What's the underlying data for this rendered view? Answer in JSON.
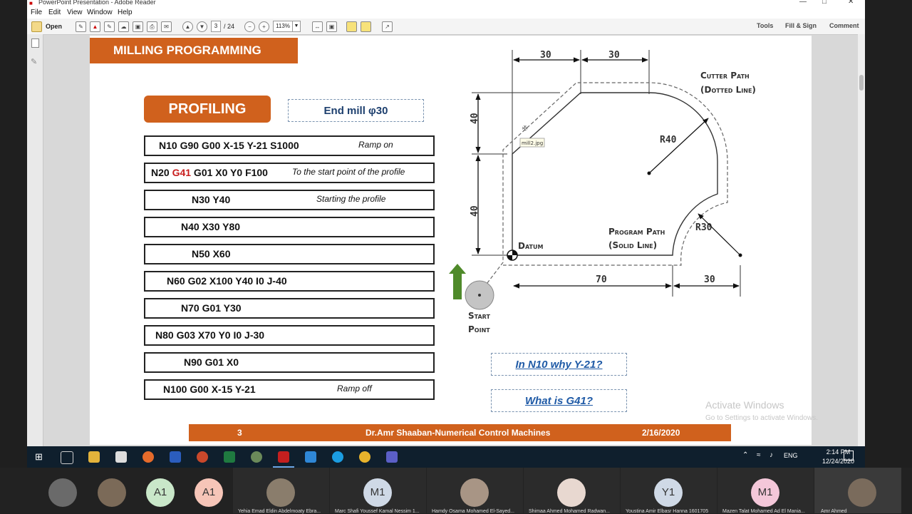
{
  "window": {
    "title": "PowerPoint Presentation - Adobe Reader",
    "menu": [
      "File",
      "Edit",
      "View",
      "Window",
      "Help"
    ],
    "toolbar": {
      "open_label": "Open",
      "page_current": "3",
      "page_total": "/ 24",
      "zoom": "113%",
      "tools": "Tools",
      "fill_sign": "Fill & Sign",
      "comment": "Comment"
    }
  },
  "slide": {
    "header": "MILLING PROGRAMMING",
    "section": "PROFILING",
    "tool": "End mill φ30",
    "program": [
      {
        "code": "N10 G90 G00 X-15 Y-21 S1000",
        "comment": "Ramp on"
      },
      {
        "code_before": "N20 ",
        "code_red": "G41",
        "code_after": " G01 X0 Y0 F100",
        "comment": "To the start point of the profile"
      },
      {
        "code": "N30 Y40",
        "comment": "Starting the profile"
      },
      {
        "code": "N40 X30 Y80",
        "comment": ""
      },
      {
        "code": "N50 X60",
        "comment": ""
      },
      {
        "code": "N60 G02 X100 Y40 I0 J-40",
        "comment": ""
      },
      {
        "code": "N70 G01 Y30",
        "comment": ""
      },
      {
        "code": "N80 G03 X70 Y0 I0 J-30",
        "comment": ""
      },
      {
        "code": "N90 G01 X0",
        "comment": ""
      },
      {
        "code": "N100 G00 X-15 Y-21",
        "comment": "Ramp off"
      }
    ],
    "questions": [
      "In N10 why Y-21?",
      "What is G41?"
    ],
    "drawing": {
      "dim_top_1": "30",
      "dim_top_2": "30",
      "dim_left_1": "40",
      "dim_left_2": "40",
      "dim_bottom_1": "70",
      "dim_bottom_2": "30",
      "r_large": "R40",
      "r_small": "R30",
      "cutter_path_1": "Cutter Path",
      "cutter_path_2": "(Dotted Line)",
      "program_path_1": "Program Path",
      "program_path_2": "(Solid Line)",
      "datum": "Datum",
      "start_1": "Start",
      "start_2": "Point",
      "tooltip": "mill2.jpg"
    },
    "footer": {
      "page": "3",
      "author": "Dr.Amr Shaaban-Numerical Control Machines",
      "date": "2/16/2020"
    }
  },
  "watermark": {
    "line1": "Activate Windows",
    "line2": "Go to Settings to activate Windows."
  },
  "taskbar": {
    "lang": "ENG",
    "time": "2:14 PM",
    "date": "12/24/2020"
  },
  "participants": [
    {
      "initials": "",
      "name": ""
    },
    {
      "initials": "",
      "name": ""
    },
    {
      "initials": "A1",
      "name": ""
    },
    {
      "initials": "A1",
      "name": ""
    },
    {
      "initials": "",
      "name": "Yehia Emad Eldin Abdelmoaty Ebra..."
    },
    {
      "initials": "M1",
      "name": "Marc Shafi Youssef Kamal  Nessim 1..."
    },
    {
      "initials": "",
      "name": "Hamdy Osama Mohamed El-Sayed..."
    },
    {
      "initials": "",
      "name": "Shimaa Ahmed Mohamed Radwan..."
    },
    {
      "initials": "Y1",
      "name": "Youstina Amir Elbasr Hanna 1601705"
    },
    {
      "initials": "M1",
      "name": "Mazen Talat Mohamed Ad El Mania..."
    },
    {
      "initials": "",
      "name": "Amr Ahmed"
    }
  ]
}
